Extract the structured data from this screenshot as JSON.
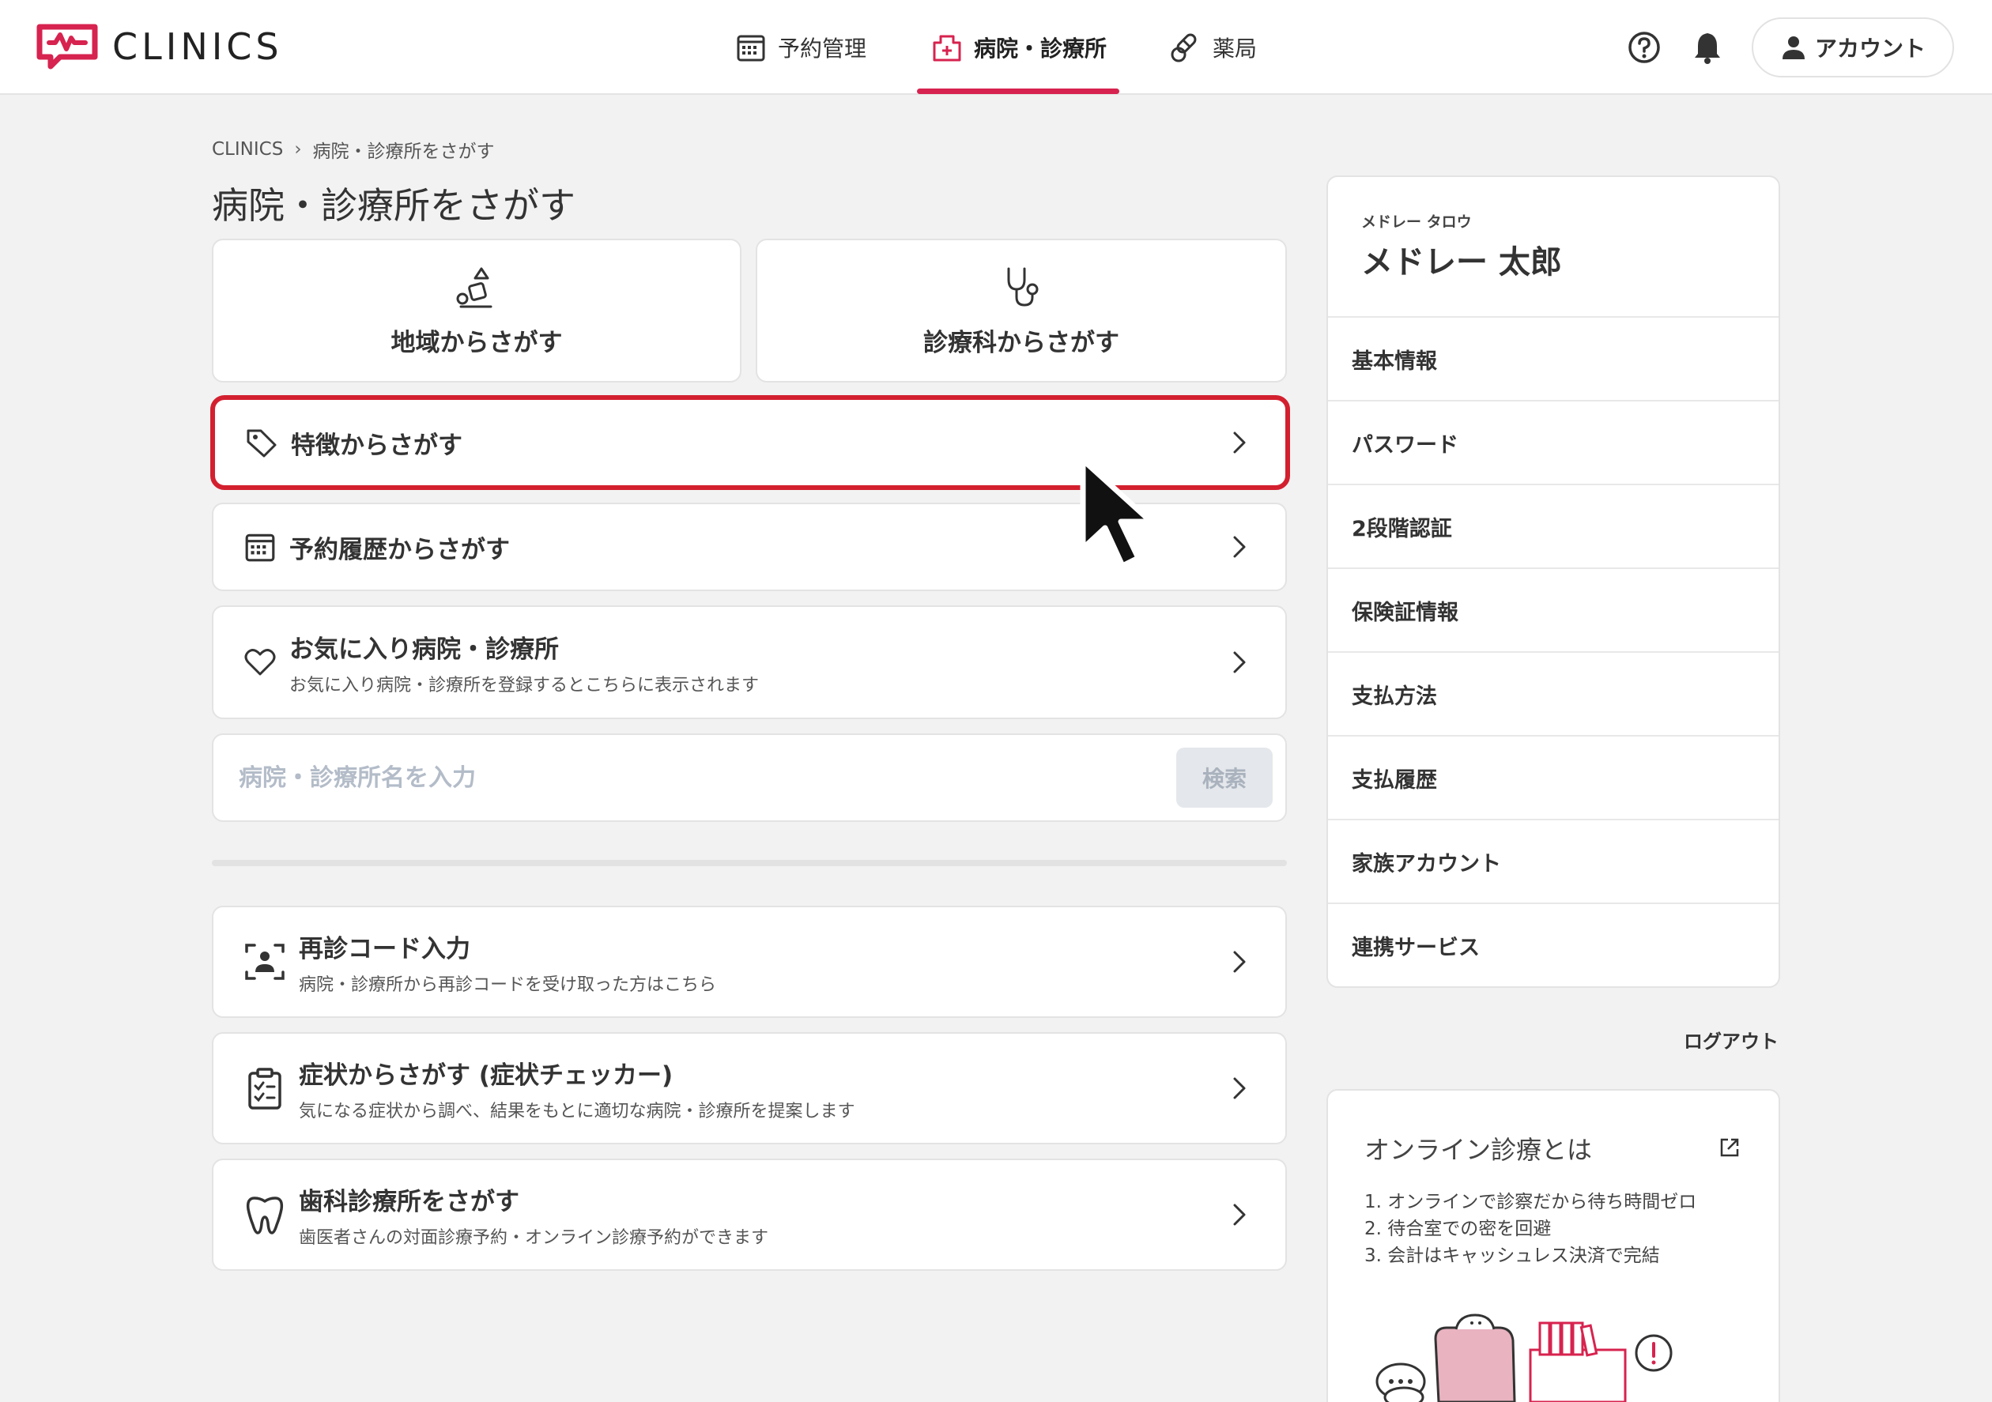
{
  "header": {
    "logo_text": "CLINICS",
    "nav": [
      {
        "label": "予約管理",
        "icon": "calendar-icon"
      },
      {
        "label": "病院・診療所",
        "icon": "hospital-icon",
        "active": true
      },
      {
        "label": "薬局",
        "icon": "pill-icon"
      }
    ],
    "account_label": "アカウント",
    "accent_color": "#d7234f"
  },
  "breadcrumb": {
    "root": "CLINICS",
    "current": "病院・診療所をさがす"
  },
  "page_title": "病院・診療所をさがす",
  "tiles": [
    {
      "label": "地域からさがす",
      "icon": "map-shapes-icon"
    },
    {
      "label": "診療科からさがす",
      "icon": "stethoscope-icon"
    }
  ],
  "rows": [
    {
      "title": "特徴からさがす",
      "icon": "tag-icon"
    },
    {
      "title": "予約履歴からさがす",
      "icon": "calendar-icon"
    },
    {
      "title": "お気に入り病院・診療所",
      "subtitle": "お気に入り病院・診療所を登録するとこちらに表示されます",
      "icon": "heart-icon"
    }
  ],
  "search": {
    "placeholder": "病院・診療所名を入力",
    "value": "",
    "button_label": "検索"
  },
  "lower_rows": [
    {
      "title": "再診コード入力",
      "subtitle": "病院・診療所から再診コードを受け取った方はこちら",
      "icon": "scan-person-icon"
    },
    {
      "title": "症状からさがす (症状チェッカー)",
      "subtitle": "気になる症状から調べ、結果をもとに適切な病院・診療所を提案します",
      "icon": "clipboard-check-icon"
    },
    {
      "title": "歯科診療所をさがす",
      "subtitle": "歯医者さんの対面診療予約・オンライン診療予約ができます",
      "icon": "tooth-icon"
    }
  ],
  "sidebar": {
    "kana": "メドレー タロウ",
    "name": "メドレー 太郎",
    "items": [
      "基本情報",
      "パスワード",
      "2段階認証",
      "保険証情報",
      "支払方法",
      "支払履歴",
      "家族アカウント",
      "連携サービス"
    ],
    "logout_label": "ログアウト"
  },
  "online": {
    "title": "オンライン診療とは",
    "points": [
      "1. オンラインで診察だから待ち時間ゼロ",
      "2. 待合室での密を回避",
      "3. 会計はキャッシュレス決済で完結"
    ]
  }
}
